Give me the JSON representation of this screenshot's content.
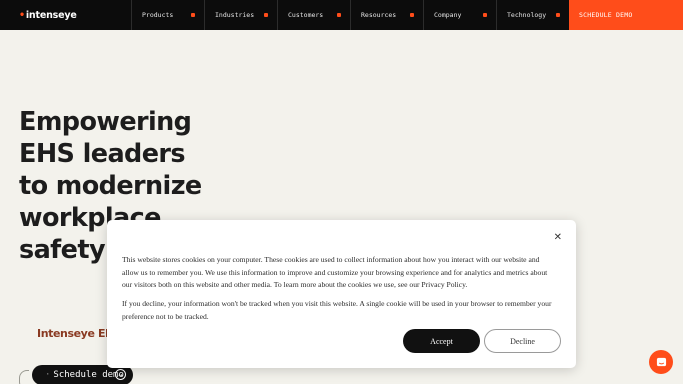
{
  "nav": {
    "logo_text": "intenseye",
    "items": [
      {
        "label": "Products"
      },
      {
        "label": "Industries"
      },
      {
        "label": "Customers"
      },
      {
        "label": "Resources"
      },
      {
        "label": "Company"
      },
      {
        "label": "Technology"
      }
    ],
    "cta_label": "SCHEDULE DEMO"
  },
  "hero": {
    "title_lines": [
      "Empowering",
      "EHS leaders",
      "to modernize",
      "workplace",
      "safety w"
    ],
    "product_tag": "Intenseye EHS Platform",
    "demo_button_label": "Schedule demo"
  },
  "cookie_modal": {
    "paragraph_1": "This website stores cookies on your computer. These cookies are used to collect information about how you interact with our website and allow us to remember you. We use this information to improve and customize your browsing experience and for analytics and metrics about our visitors both on this website and other media. To learn more about the cookies we use, see our Privacy Policy.",
    "paragraph_2": "If you decline, your information won't be tracked when you visit this website. A single cookie will be used in your browser to remember your preference not to be tracked.",
    "accept_label": "Accept",
    "decline_label": "Decline",
    "close_icon": "close-icon"
  },
  "colors": {
    "accent": "#ff4d1a",
    "nav_bg": "#0c0c0c",
    "page_bg": "#f3f2ec"
  }
}
